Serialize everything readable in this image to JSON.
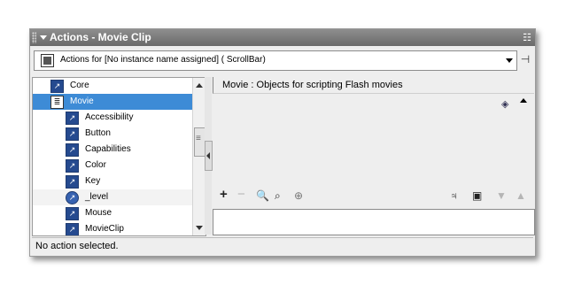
{
  "panel": {
    "title": "Actions - Movie Clip"
  },
  "target": {
    "label": "Actions for [No instance name assigned]  ( ScrollBar)"
  },
  "toolbox": {
    "items": [
      {
        "label": "Core",
        "icon": "arrow-book-icon",
        "selected": false
      },
      {
        "label": "Movie",
        "icon": "book-icon",
        "selected": true
      },
      {
        "label": "Accessibility",
        "icon": "arrow-book-icon",
        "selected": false
      },
      {
        "label": "Button",
        "icon": "arrow-book-icon",
        "selected": false
      },
      {
        "label": "Capabilities",
        "icon": "arrow-book-icon",
        "selected": false
      },
      {
        "label": "Color",
        "icon": "arrow-book-icon",
        "selected": false
      },
      {
        "label": "Key",
        "icon": "arrow-book-icon",
        "selected": false
      },
      {
        "label": "_level",
        "icon": "round-arrow-icon",
        "selected": false
      },
      {
        "label": "Mouse",
        "icon": "arrow-book-icon",
        "selected": false
      },
      {
        "label": "MovieClip",
        "icon": "arrow-book-icon",
        "selected": false
      }
    ]
  },
  "script_pane": {
    "header": "Movie : Objects for scripting Flash movies"
  },
  "toolbar": {
    "add": "+",
    "remove": "−",
    "find": "find-icon",
    "replace": "replace-icon",
    "target": "target-icon",
    "debug": "debug-options-icon",
    "view_options": "view-options-icon",
    "move_down": "move-down-icon",
    "move_up": "move-up-icon"
  },
  "status": {
    "text": "No action selected."
  },
  "colors": {
    "selection": "#3d8bd6",
    "titlebar": "#7a7a7a",
    "panel_bg": "#eeeeee"
  }
}
